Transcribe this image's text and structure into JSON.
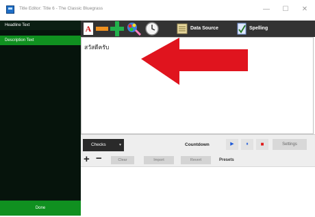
{
  "window": {
    "title": "Title Editor: Title 6 - The Classic Bluegrass",
    "minimize_label": "—",
    "maximize_label": "☐",
    "close_label": "✕"
  },
  "sidebar": {
    "items": [
      {
        "label": "Headline Text"
      },
      {
        "label": "Description Text"
      }
    ],
    "bottom_button": "Done"
  },
  "toolbar": {
    "icons": [
      "text-color-icon",
      "remove-icon",
      "add-icon",
      "color-picker-icon",
      "clock-icon"
    ],
    "data_source_label": "Data Source",
    "spelling_label": "Spelling"
  },
  "editor": {
    "content": "สวัสดีครับ"
  },
  "controls": {
    "check_label": "Checks",
    "countdown_label": "Countdown",
    "play_symbol": "▶",
    "pause_symbol": "⏸",
    "stop_symbol": "■",
    "settings_label": "Settings"
  },
  "presets": {
    "clear_label": "Clear",
    "import_label": "Import",
    "revert_label": "Revert",
    "presets_label": "Presets"
  },
  "colors": {
    "sidebar_bg": "#06140c",
    "active_green": "#109020",
    "toolbar_bg": "#333333",
    "arrow_red": "#e0141e"
  }
}
